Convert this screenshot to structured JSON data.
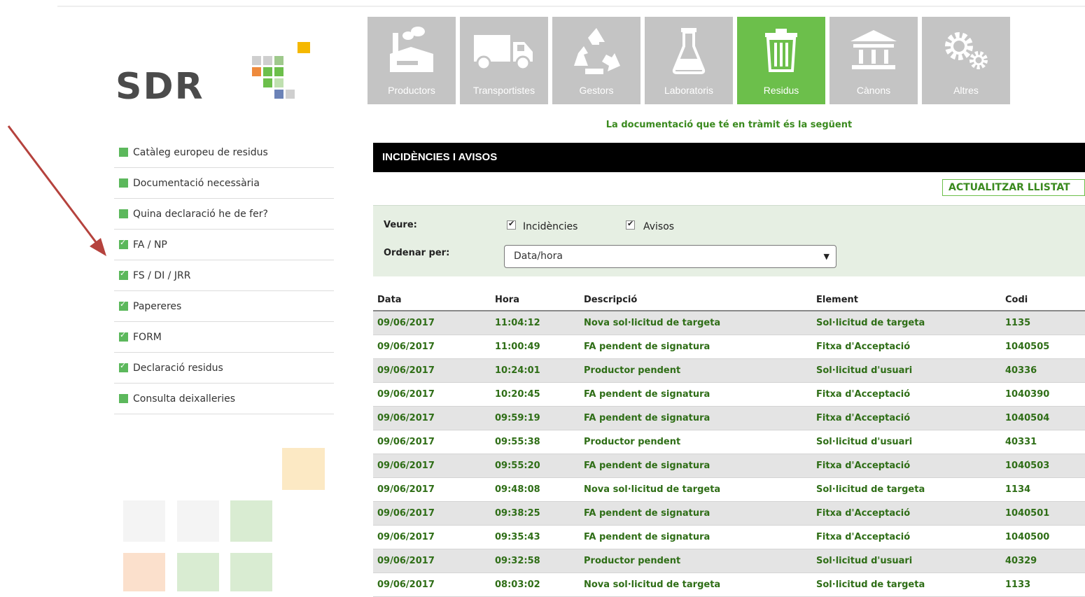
{
  "logo": {
    "text": "SDR"
  },
  "sidebar": {
    "items": [
      {
        "label": "Catàleg europeu de residus",
        "checked": false
      },
      {
        "label": "Documentació necessària",
        "checked": false
      },
      {
        "label": "Quina declaració he de fer?",
        "checked": false
      },
      {
        "label": "FA / NP",
        "checked": true
      },
      {
        "label": "FS / DI / JRR",
        "checked": true
      },
      {
        "label": "Papereres",
        "checked": true
      },
      {
        "label": "FORM",
        "checked": true
      },
      {
        "label": "Declaració residus",
        "checked": true
      },
      {
        "label": "Consulta deixalleries",
        "checked": false
      }
    ]
  },
  "nav": {
    "tiles": [
      {
        "label": "Productors",
        "icon": "factory-icon"
      },
      {
        "label": "Transportistes",
        "icon": "truck-icon"
      },
      {
        "label": "Gestors",
        "icon": "recycle-icon"
      },
      {
        "label": "Laboratoris",
        "icon": "flask-icon"
      },
      {
        "label": "Residus",
        "icon": "trash-icon",
        "active": true
      },
      {
        "label": "Cànons",
        "icon": "institution-icon"
      },
      {
        "label": "Altres",
        "icon": "gears-icon"
      }
    ]
  },
  "notice": "La documentació que té en tràmit és la següent",
  "panel": {
    "title": "INCIDÈNCIES I AVISOS",
    "refresh_label": "ACTUALITZAR LLISTAT"
  },
  "filters": {
    "view_label": "Veure:",
    "incidences_label": "Incidències",
    "incidences_checked": true,
    "notices_label": "Avisos",
    "notices_checked": true,
    "order_label": "Ordenar per:",
    "order_value": "Data/hora"
  },
  "table": {
    "headers": [
      "Data",
      "Hora",
      "Descripció",
      "Element",
      "Codi"
    ],
    "rows": [
      [
        "09/06/2017",
        "11:04:12",
        "Nova sol·licitud de targeta",
        "Sol·licitud de targeta",
        "1135"
      ],
      [
        "09/06/2017",
        "11:00:49",
        "FA pendent de signatura",
        "Fitxa d'Acceptació",
        "1040505"
      ],
      [
        "09/06/2017",
        "10:24:01",
        "Productor pendent",
        "Sol·licitud d'usuari",
        "40336"
      ],
      [
        "09/06/2017",
        "10:20:45",
        "FA pendent de signatura",
        "Fitxa d'Acceptació",
        "1040390"
      ],
      [
        "09/06/2017",
        "09:59:19",
        "FA pendent de signatura",
        "Fitxa d'Acceptació",
        "1040504"
      ],
      [
        "09/06/2017",
        "09:55:38",
        "Productor pendent",
        "Sol·licitud d'usuari",
        "40331"
      ],
      [
        "09/06/2017",
        "09:55:20",
        "FA pendent de signatura",
        "Fitxa d'Acceptació",
        "1040503"
      ],
      [
        "09/06/2017",
        "09:48:08",
        "Nova sol·licitud de targeta",
        "Sol·licitud de targeta",
        "1134"
      ],
      [
        "09/06/2017",
        "09:38:25",
        "FA pendent de signatura",
        "Fitxa d'Acceptació",
        "1040501"
      ],
      [
        "09/06/2017",
        "09:35:43",
        "FA pendent de signatura",
        "Fitxa d'Acceptació",
        "1040500"
      ],
      [
        "09/06/2017",
        "09:32:58",
        "Productor pendent",
        "Sol·licitud d'usuari",
        "40329"
      ],
      [
        "09/06/2017",
        "08:03:02",
        "Nova sol·licitud de targeta",
        "Sol·licitud de targeta",
        "1133"
      ]
    ]
  },
  "colors": {
    "accent_green": "#6cbf4b",
    "tile_gray": "#c4c4c4",
    "link_green": "#2f6e17",
    "annotation_arrow": "#b5423d"
  }
}
